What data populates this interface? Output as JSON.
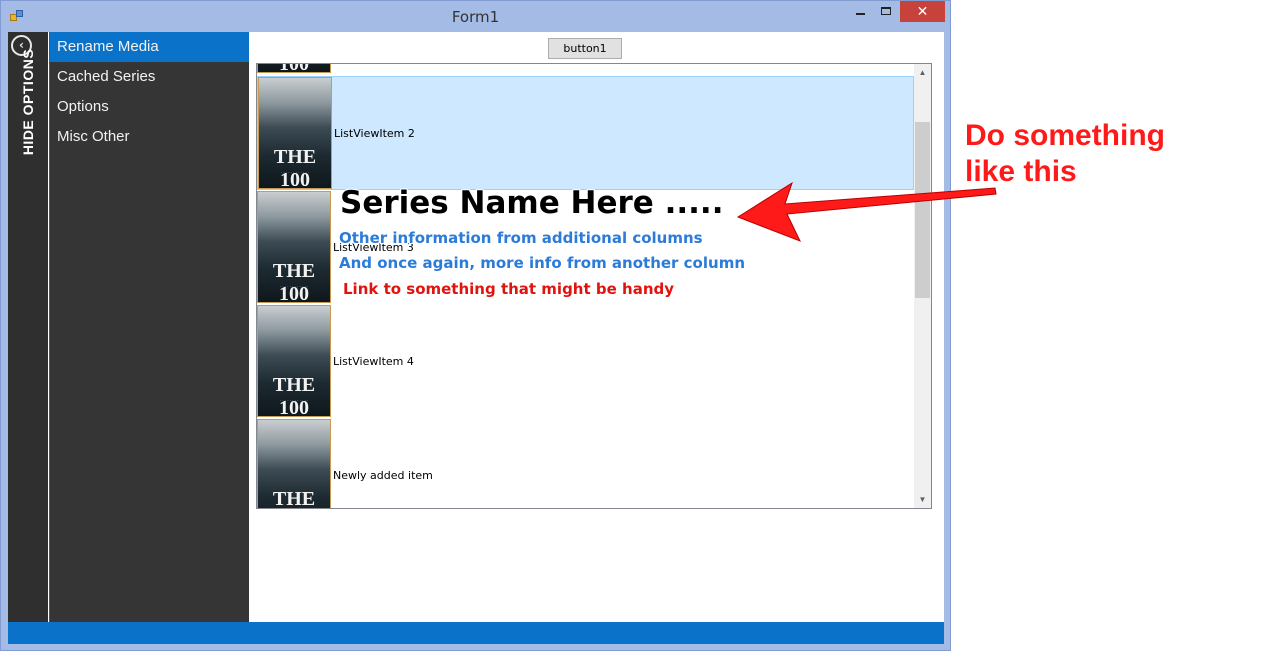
{
  "window": {
    "title": "Form1",
    "close_glyph": "✕"
  },
  "hide_panel": {
    "label": "HIDE OPTIONS",
    "back_glyph": "‹"
  },
  "sidebar": {
    "items": [
      {
        "label": "Rename Media",
        "active": true
      },
      {
        "label": "Cached Series"
      },
      {
        "label": "Options"
      },
      {
        "label": "Misc Other"
      }
    ]
  },
  "toolbar": {
    "button1_label": "button1"
  },
  "listview": {
    "items": [
      {
        "label": "ListViewItem 2",
        "selected": true
      },
      {
        "label": "ListViewItem 3"
      },
      {
        "label": "ListViewItem 4"
      },
      {
        "label": "Newly added item"
      }
    ],
    "poster_title": "THE 100"
  },
  "annotation": {
    "series_name": "Series Name Here .....",
    "info_line_1": "Other information from additional columns",
    "info_line_2": "And once again, more info from another column",
    "link_text": "Link to something that might be handy",
    "callout_line_1": "Do something",
    "callout_line_2": "like this"
  },
  "colors": {
    "accent": "#0a73c9",
    "sidebar_bg": "#353535",
    "selection": "#cde8ff",
    "annotation_red": "#ff1a1a",
    "annotation_blue": "#2b7bd9"
  }
}
